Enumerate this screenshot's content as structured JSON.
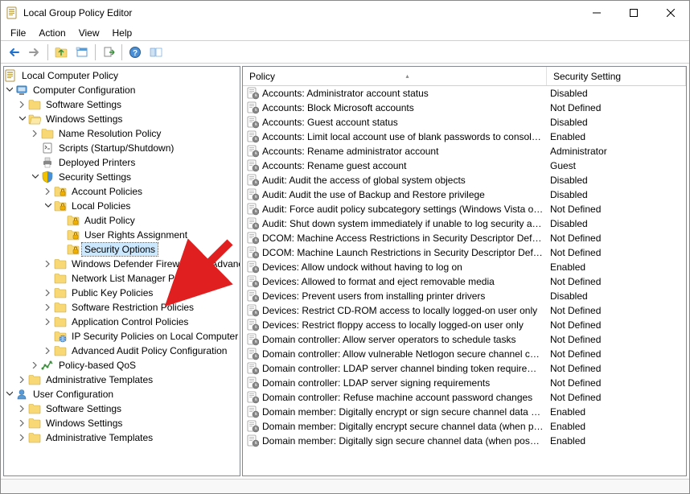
{
  "window": {
    "title": "Local Group Policy Editor"
  },
  "menu": {
    "items": [
      "File",
      "Action",
      "View",
      "Help"
    ]
  },
  "tree": {
    "root": "Local Computer Policy",
    "cc": "Computer Configuration",
    "ss": "Software Settings",
    "ws": "Windows Settings",
    "nrp": "Name Resolution Policy",
    "scripts": "Scripts (Startup/Shutdown)",
    "dep": "Deployed Printers",
    "sec": "Security Settings",
    "ap": "Account Policies",
    "lp": "Local Policies",
    "aup": "Audit Policy",
    "ura": "User Rights Assignment",
    "so": "Security Options",
    "wdf": "Windows Defender Firewall with Advanced Security",
    "nlm": "Network List Manager Policies",
    "pkp": "Public Key Policies",
    "srp": "Software Restriction Policies",
    "acp": "Application Control Policies",
    "ips": "IP Security Policies on Local Computer",
    "aapc": "Advanced Audit Policy Configuration",
    "pqos": "Policy-based QoS",
    "at": "Administrative Templates",
    "uc": "User Configuration",
    "uss": "Software Settings",
    "uws": "Windows Settings",
    "uat": "Administrative Templates"
  },
  "list": {
    "col_policy": "Policy",
    "col_setting": "Security Setting",
    "rows": [
      {
        "p": "Accounts: Administrator account status",
        "s": "Disabled"
      },
      {
        "p": "Accounts: Block Microsoft accounts",
        "s": "Not Defined"
      },
      {
        "p": "Accounts: Guest account status",
        "s": "Disabled"
      },
      {
        "p": "Accounts: Limit local account use of blank passwords to console l...",
        "s": "Enabled"
      },
      {
        "p": "Accounts: Rename administrator account",
        "s": "Administrator"
      },
      {
        "p": "Accounts: Rename guest account",
        "s": "Guest"
      },
      {
        "p": "Audit: Audit the access of global system objects",
        "s": "Disabled"
      },
      {
        "p": "Audit: Audit the use of Backup and Restore privilege",
        "s": "Disabled"
      },
      {
        "p": "Audit: Force audit policy subcategory settings (Windows Vista or l...",
        "s": "Not Defined"
      },
      {
        "p": "Audit: Shut down system immediately if unable to log security au...",
        "s": "Disabled"
      },
      {
        "p": "DCOM: Machine Access Restrictions in Security Descriptor Definiti...",
        "s": "Not Defined"
      },
      {
        "p": "DCOM: Machine Launch Restrictions in Security Descriptor Definit...",
        "s": "Not Defined"
      },
      {
        "p": "Devices: Allow undock without having to log on",
        "s": "Enabled"
      },
      {
        "p": "Devices: Allowed to format and eject removable media",
        "s": "Not Defined"
      },
      {
        "p": "Devices: Prevent users from installing printer drivers",
        "s": "Disabled"
      },
      {
        "p": "Devices: Restrict CD-ROM access to locally logged-on user only",
        "s": "Not Defined"
      },
      {
        "p": "Devices: Restrict floppy access to locally logged-on user only",
        "s": "Not Defined"
      },
      {
        "p": "Domain controller: Allow server operators to schedule tasks",
        "s": "Not Defined"
      },
      {
        "p": "Domain controller: Allow vulnerable Netlogon secure channel con...",
        "s": "Not Defined"
      },
      {
        "p": "Domain controller: LDAP server channel binding token requireme...",
        "s": "Not Defined"
      },
      {
        "p": "Domain controller: LDAP server signing requirements",
        "s": "Not Defined"
      },
      {
        "p": "Domain controller: Refuse machine account password changes",
        "s": "Not Defined"
      },
      {
        "p": "Domain member: Digitally encrypt or sign secure channel data (al...",
        "s": "Enabled"
      },
      {
        "p": "Domain member: Digitally encrypt secure channel data (when pos...",
        "s": "Enabled"
      },
      {
        "p": "Domain member: Digitally sign secure channel data (when possible)",
        "s": "Enabled"
      }
    ]
  }
}
